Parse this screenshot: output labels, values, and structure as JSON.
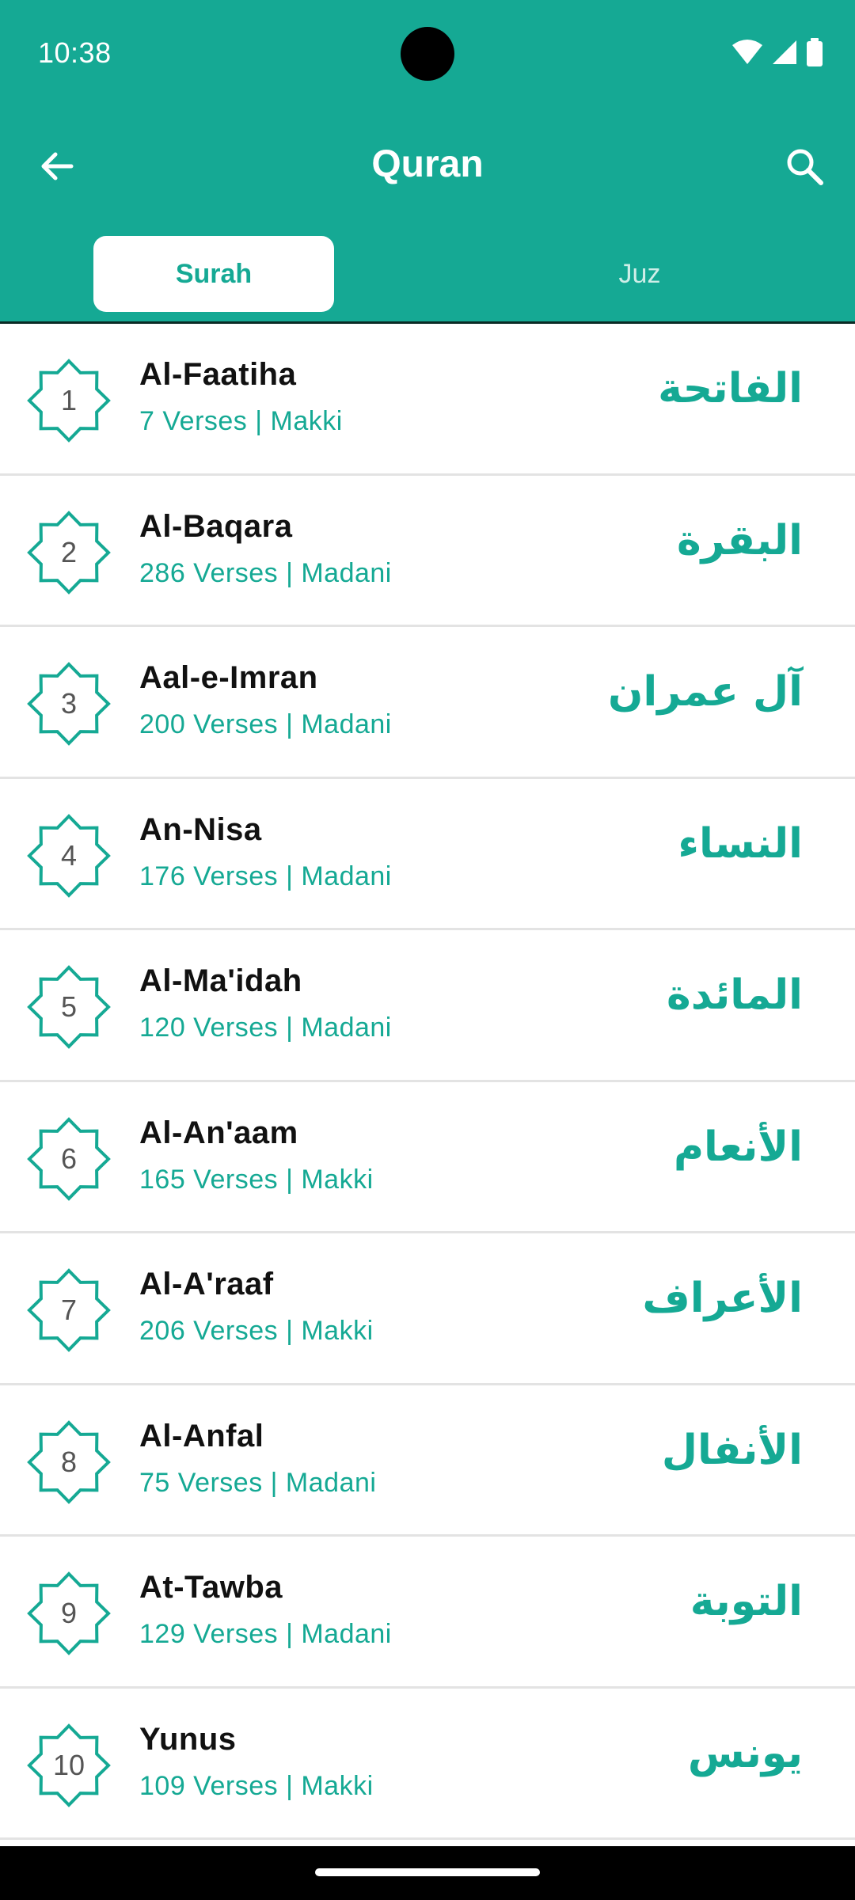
{
  "status_bar": {
    "time": "10:38"
  },
  "app_bar": {
    "title": "Quran"
  },
  "tabs": [
    {
      "label": "Surah",
      "active": true
    },
    {
      "label": "Juz",
      "active": false
    }
  ],
  "colors": {
    "accent": "#15a994",
    "divider": "#e3e3e3"
  },
  "surahs": [
    {
      "number": "1",
      "name": "Al-Faatiha",
      "meta": "7 Verses | Makki",
      "arabic": "الفاتحة"
    },
    {
      "number": "2",
      "name": "Al-Baqara",
      "meta": "286 Verses | Madani",
      "arabic": "البقرة"
    },
    {
      "number": "3",
      "name": "Aal-e-Imran",
      "meta": "200 Verses | Madani",
      "arabic": "آل عمران"
    },
    {
      "number": "4",
      "name": "An-Nisa",
      "meta": "176 Verses | Madani",
      "arabic": "النساء"
    },
    {
      "number": "5",
      "name": "Al-Ma'idah",
      "meta": "120 Verses | Madani",
      "arabic": "المائدة"
    },
    {
      "number": "6",
      "name": "Al-An'aam",
      "meta": "165 Verses | Makki",
      "arabic": "الأنعام"
    },
    {
      "number": "7",
      "name": "Al-A'raaf",
      "meta": "206 Verses | Makki",
      "arabic": "الأعراف"
    },
    {
      "number": "8",
      "name": "Al-Anfal",
      "meta": "75 Verses | Madani",
      "arabic": "الأنفال"
    },
    {
      "number": "9",
      "name": "At-Tawba",
      "meta": "129 Verses | Madani",
      "arabic": "التوبة"
    },
    {
      "number": "10",
      "name": "Yunus",
      "meta": "109 Verses | Makki",
      "arabic": "يونس"
    }
  ]
}
